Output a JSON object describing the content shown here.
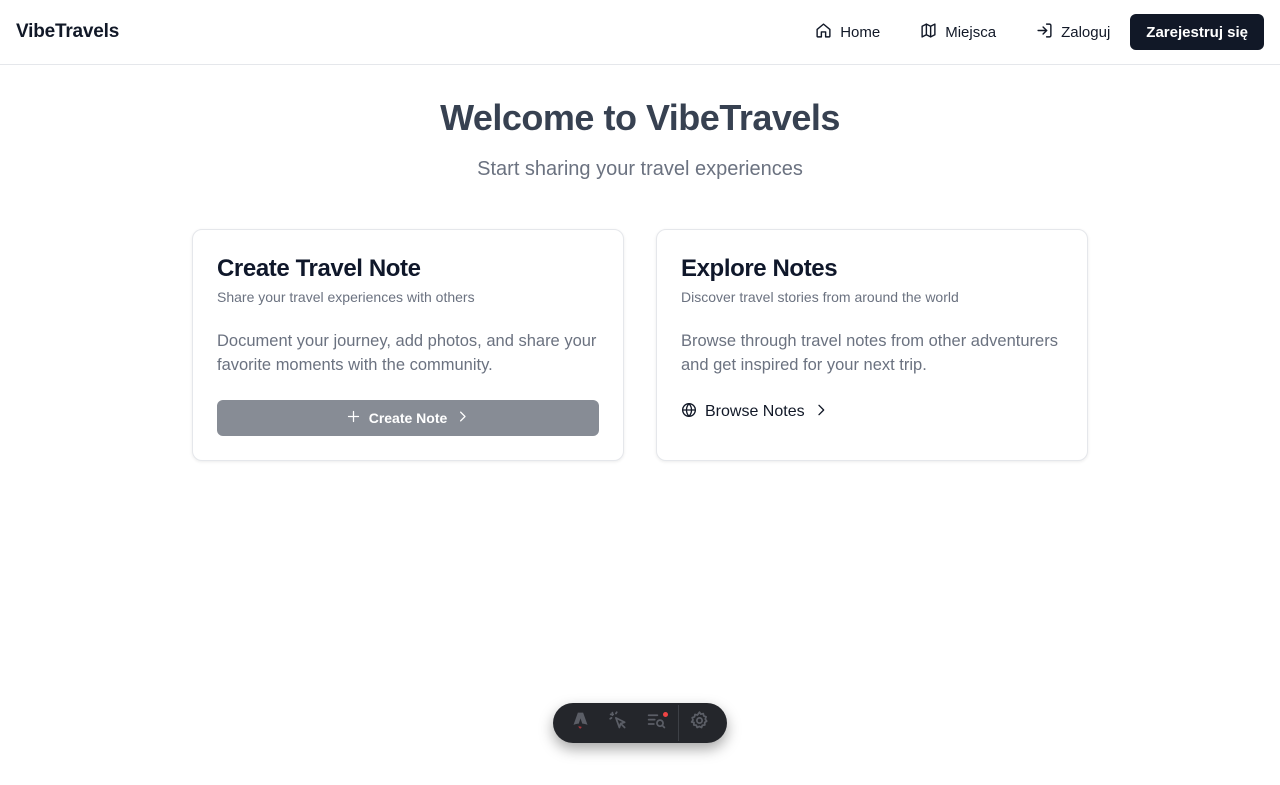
{
  "nav": {
    "brand": "VibeTravels",
    "links": [
      {
        "label": "Home",
        "icon": "home-icon"
      },
      {
        "label": "Miejsca",
        "icon": "map-icon"
      },
      {
        "label": "Zaloguj",
        "icon": "login-icon"
      }
    ],
    "register_label": "Zarejestruj się"
  },
  "hero": {
    "title": "Welcome to VibeTravels",
    "subtitle": "Start sharing your travel experiences"
  },
  "cards": [
    {
      "title": "Create Travel Note",
      "subtitle": "Share your travel experiences with others",
      "body": "Document your journey, add photos, and share your favorite moments with the community.",
      "action_label": "Create Note"
    },
    {
      "title": "Explore Notes",
      "subtitle": "Discover travel stories from around the world",
      "body": "Browse through travel notes from other adventurers and get inspired for your next trip.",
      "action_label": "Browse Notes"
    }
  ],
  "colors": {
    "primary_dark": "#111827",
    "create_button": "#878c95",
    "devbar": "#24262b",
    "notification_dot": "#ef4444"
  },
  "devbar": {
    "icons": [
      "astro-logo-icon",
      "inspect-cursor-icon",
      "audit-icon",
      "settings-gear-icon"
    ]
  }
}
